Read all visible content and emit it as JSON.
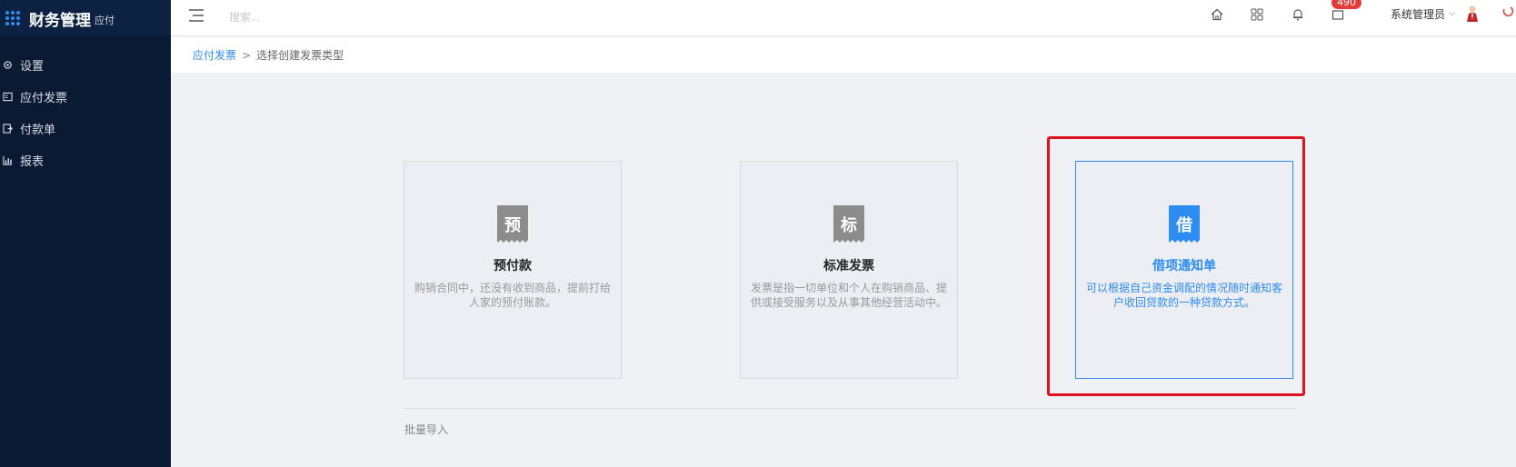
{
  "brand": {
    "title": "财务管理",
    "subtitle": "应付"
  },
  "sidebar": {
    "items": [
      {
        "label": "设置",
        "icon": "gear-icon"
      },
      {
        "label": "应付发票",
        "icon": "invoice-icon"
      },
      {
        "label": "付款单",
        "icon": "payment-icon"
      },
      {
        "label": "报表",
        "icon": "chart-icon"
      }
    ]
  },
  "topbar": {
    "search_placeholder": "搜索...",
    "notification_count": "490",
    "user_name": "系统管理员"
  },
  "breadcrumb": {
    "parent": "应付发票",
    "separator": ">",
    "current": "选择创建发票类型"
  },
  "cards": [
    {
      "icon_char": "预",
      "title": "预付款",
      "description": "购销合同中，还没有收到商品，提前打给人家的预付账款。",
      "icon_color": "#8c8c8c"
    },
    {
      "icon_char": "标",
      "title": "标准发票",
      "description": "发票是指一切单位和个人在购销商品、提供或接受服务以及从事其他经营活动中。",
      "icon_color": "#8c8c8c"
    },
    {
      "icon_char": "借",
      "title": "借项通知单",
      "description": "可以根据自己资金调配的情况随时通知客户收回贷款的一种贷款方式。",
      "icon_color": "#2d8cf0"
    }
  ],
  "batch_import": "批量导入",
  "colors": {
    "accent": "#2d8cf0",
    "sidebar_bg": "#0b1a33",
    "highlight": "#e0121b",
    "badge": "#e43b3b"
  }
}
